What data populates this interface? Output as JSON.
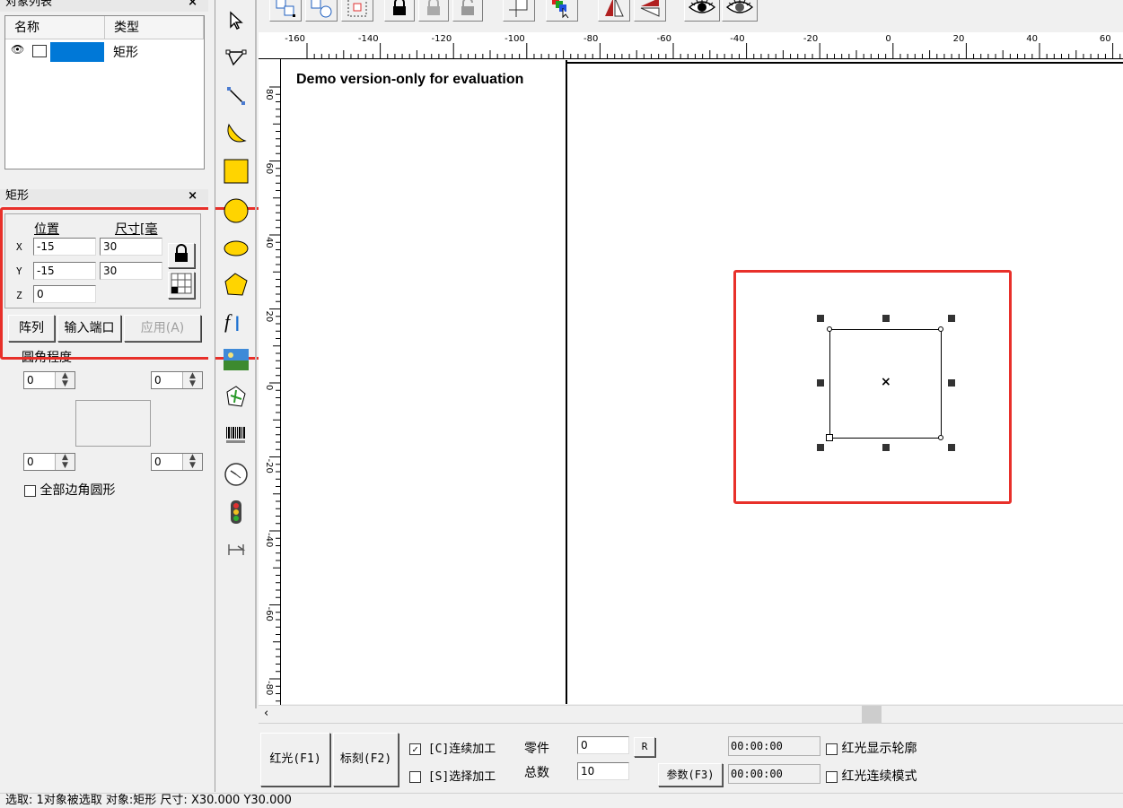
{
  "object_list": {
    "title": "对象列表",
    "close": "×",
    "col_name": "名称",
    "col_type": "类型",
    "rows": [
      {
        "type": "矩形"
      }
    ]
  },
  "props": {
    "title": "矩形",
    "close": "×",
    "position_label": "位置",
    "size_label": "尺寸[毫",
    "x_label": "X",
    "y_label": "Y",
    "z_label": "Z",
    "x_pos": "-15",
    "x_size": "30",
    "y_pos": "-15",
    "y_size": "30",
    "z_pos": "0",
    "btn_array": "阵列",
    "btn_input_port": "输入端口",
    "btn_apply": "应用(A)",
    "round_label": "圆角程度",
    "spin_tl": "0",
    "spin_tr": "0",
    "spin_bl": "0",
    "spin_br": "0",
    "all_round_label": "全部边角圆形"
  },
  "canvas": {
    "demo_text": "Demo version-only for evaluation",
    "h_ticks": [
      "-160",
      "-140",
      "-120",
      "-100",
      "-80",
      "-60",
      "-40",
      "-20",
      "0",
      "20",
      "40",
      "60"
    ],
    "v_ticks": [
      "80",
      "60",
      "40",
      "20",
      "0",
      "-20",
      "-40",
      "-60",
      "-80"
    ]
  },
  "bottom": {
    "btn_red_light": "红光(F1)",
    "btn_mark": "标刻(F2)",
    "continuous_label": "[C]连续加工",
    "continuous_checked": true,
    "select_label": "[S]选择加工",
    "select_checked": false,
    "parts_label": "零件",
    "parts_value": "0",
    "total_label": "总数",
    "total_value": "10",
    "r_btn": "R",
    "params_btn": "参数(F3)",
    "time1": "00:00:00",
    "time2": "00:00:00",
    "show_contour_label": "红光显示轮廓",
    "continuous_mode_label": "红光连续模式"
  },
  "status": {
    "text": "选取: 1对象被选取 对象:矩形 尺寸: X30.000 Y30.000"
  },
  "colors": {
    "highlight": "#0078d7",
    "annotation": "#e8302a",
    "shape_yellow": "#ffd400"
  }
}
